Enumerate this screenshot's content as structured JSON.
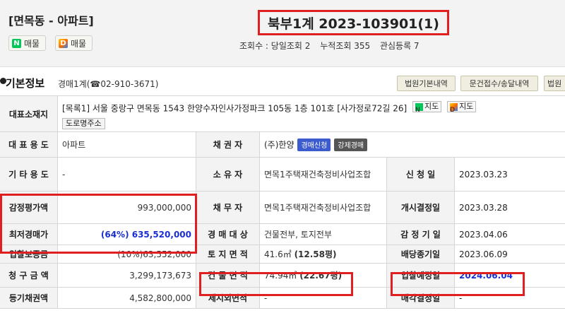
{
  "header": {
    "location_title": "[면목동 - 아파트]",
    "naver_logo": "N",
    "naver_label": "매물",
    "daum_logo": "D",
    "daum_label": "매물",
    "case_number": "북부1계 2023-103901(1)",
    "stats": {
      "today_views": "조회수 : 당일조회 2",
      "total_views": "누적조회 355",
      "watch_count": "관심등록 7"
    }
  },
  "section": {
    "bullet": "•",
    "title": "기본정보",
    "court_info": "경매1계(☎02-910-3671)",
    "buttons": [
      "법원기본내역",
      "문건접수/송달내역",
      "법원"
    ]
  },
  "table": {
    "address": {
      "label": "대표소재지",
      "value": "[목록1] 서울 중랑구 면목동 1543 한양수자인사가정파크 105동 1층 101호 [사가정로72길 26]",
      "naver_map_logo": "N",
      "naver_map": "지도",
      "daum_map_logo": "D",
      "daum_map": "지도",
      "road_button": "도로명주소"
    },
    "rows": {
      "usage_label": "대 표 용 도",
      "usage_value": "아파트",
      "creditor_label": "채 권 자",
      "creditor_value": "(주)한양",
      "tag_auction_apply": "경매신청",
      "tag_forced": "강제경매",
      "other_usage_label": "기 타 용 도",
      "other_usage_value": "-",
      "owner_label": "소 유 자",
      "owner_value": "면목1주택재건축정비사업조합",
      "apply_date_label": "신 청 일",
      "apply_date_value": "2023.03.23",
      "appraisal_label": "감정평가액",
      "appraisal_value": "993,000,000",
      "debtor_label": "채 무 자",
      "debtor_value": "면목1주택재건축정비사업조합",
      "start_decision_label": "개시결정일",
      "start_decision_value": "2023.03.28",
      "min_bid_label": "최저경매가",
      "min_bid_value": "(64%) 635,520,000",
      "target_label": "경 매 대 상",
      "target_value": "건물전부, 토지전부",
      "appraisal_date_label": "감 정 기 일",
      "appraisal_date_value": "2023.04.06",
      "deposit_label": "입찰보증금",
      "deposit_value": "(10%)63,552,000",
      "land_area_label": "토 지 면 적",
      "land_area_value": "41.6㎡",
      "land_area_pyeong": "(12.58평)",
      "dividend_label": "배당종기일",
      "dividend_value": "2023.06.09",
      "claim_label": "청 구 금 액",
      "claim_value": "3,299,173,673",
      "building_area_label": "건 물 면 적",
      "building_area_value": "74.94㎡",
      "building_area_pyeong": "(22.67평)",
      "bid_date_label": "입찰예정일",
      "bid_date_value": "2024.06.04",
      "registered_claim_label": "등기채권액",
      "registered_claim_value": "4,582,800,000",
      "excluded_area_label": "제시외면적",
      "excluded_area_value": "-",
      "sale_decision_label": "매각결정일",
      "sale_decision_value": "-"
    }
  },
  "colors": {
    "highlight": "#e02020",
    "accent_blue": "#1a2fd0",
    "tag_blue": "#3b5bcf",
    "header_bg": "#f3f3f3"
  }
}
